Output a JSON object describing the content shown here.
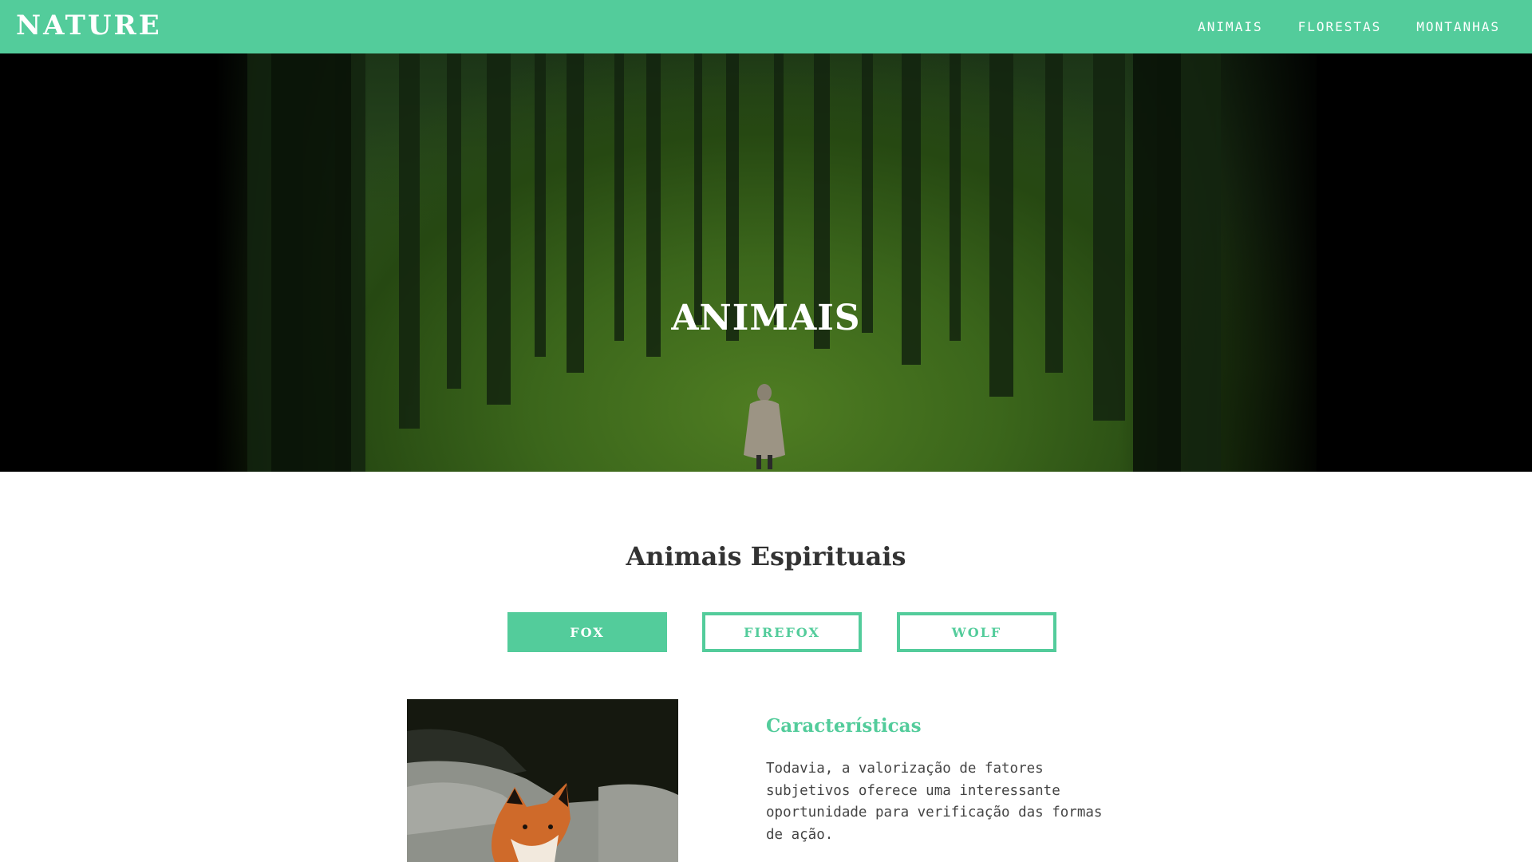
{
  "header": {
    "brand": "NATURE",
    "nav": [
      "ANIMAIS",
      "FLORESTAS",
      "MONTANHAS"
    ]
  },
  "hero": {
    "title": "ANIMAIS"
  },
  "section": {
    "title": "Animais Espirituais",
    "tabs": [
      {
        "label": "FOX",
        "active": true
      },
      {
        "label": "FIREFOX",
        "active": false
      },
      {
        "label": "WOLF",
        "active": false
      }
    ]
  },
  "detail": {
    "heading": "Características",
    "text": "Todavia, a valorização de fatores subjetivos oferece uma interessante oportunidade para verificação das formas de ação."
  },
  "colors": {
    "accent": "#53cc9b",
    "heading_text": "#333333",
    "body_text": "#444444"
  }
}
